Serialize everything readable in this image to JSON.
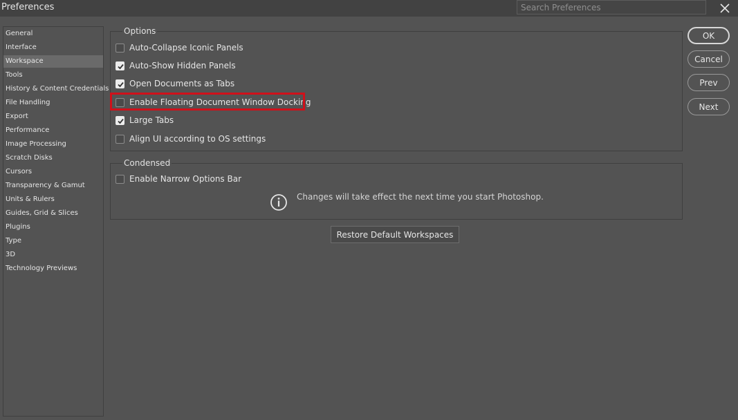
{
  "window": {
    "title": "Preferences",
    "search_placeholder": "Search Preferences"
  },
  "sidebar": {
    "items": [
      {
        "label": "General"
      },
      {
        "label": "Interface"
      },
      {
        "label": "Workspace"
      },
      {
        "label": "Tools"
      },
      {
        "label": "History & Content Credentials"
      },
      {
        "label": "File Handling"
      },
      {
        "label": "Export"
      },
      {
        "label": "Performance"
      },
      {
        "label": "Image Processing"
      },
      {
        "label": "Scratch Disks"
      },
      {
        "label": "Cursors"
      },
      {
        "label": "Transparency & Gamut"
      },
      {
        "label": "Units & Rulers"
      },
      {
        "label": "Guides, Grid & Slices"
      },
      {
        "label": "Plugins"
      },
      {
        "label": "Type"
      },
      {
        "label": "3D"
      },
      {
        "label": "Technology Previews"
      }
    ],
    "selected": "Workspace"
  },
  "options": {
    "title": "Options",
    "items": [
      {
        "label": "Auto-Collapse Iconic Panels",
        "checked": false
      },
      {
        "label": "Auto-Show Hidden Panels",
        "checked": true
      },
      {
        "label": "Open Documents as Tabs",
        "checked": true
      },
      {
        "label": "Enable Floating Document Window Docking",
        "checked": false
      },
      {
        "label": "Large Tabs",
        "checked": true
      },
      {
        "label": "Align UI according to OS settings",
        "checked": false
      }
    ]
  },
  "condensed": {
    "title": "Condensed",
    "items": [
      {
        "label": "Enable Narrow Options Bar",
        "checked": false
      }
    ],
    "info_text": "Changes will take effect the next time you start Photoshop."
  },
  "restore_button": "Restore Default Workspaces",
  "buttons": {
    "ok": "OK",
    "cancel": "Cancel",
    "prev": "Prev",
    "next": "Next"
  },
  "colors": {
    "background": "#535353",
    "highlight": "#d0101a"
  }
}
